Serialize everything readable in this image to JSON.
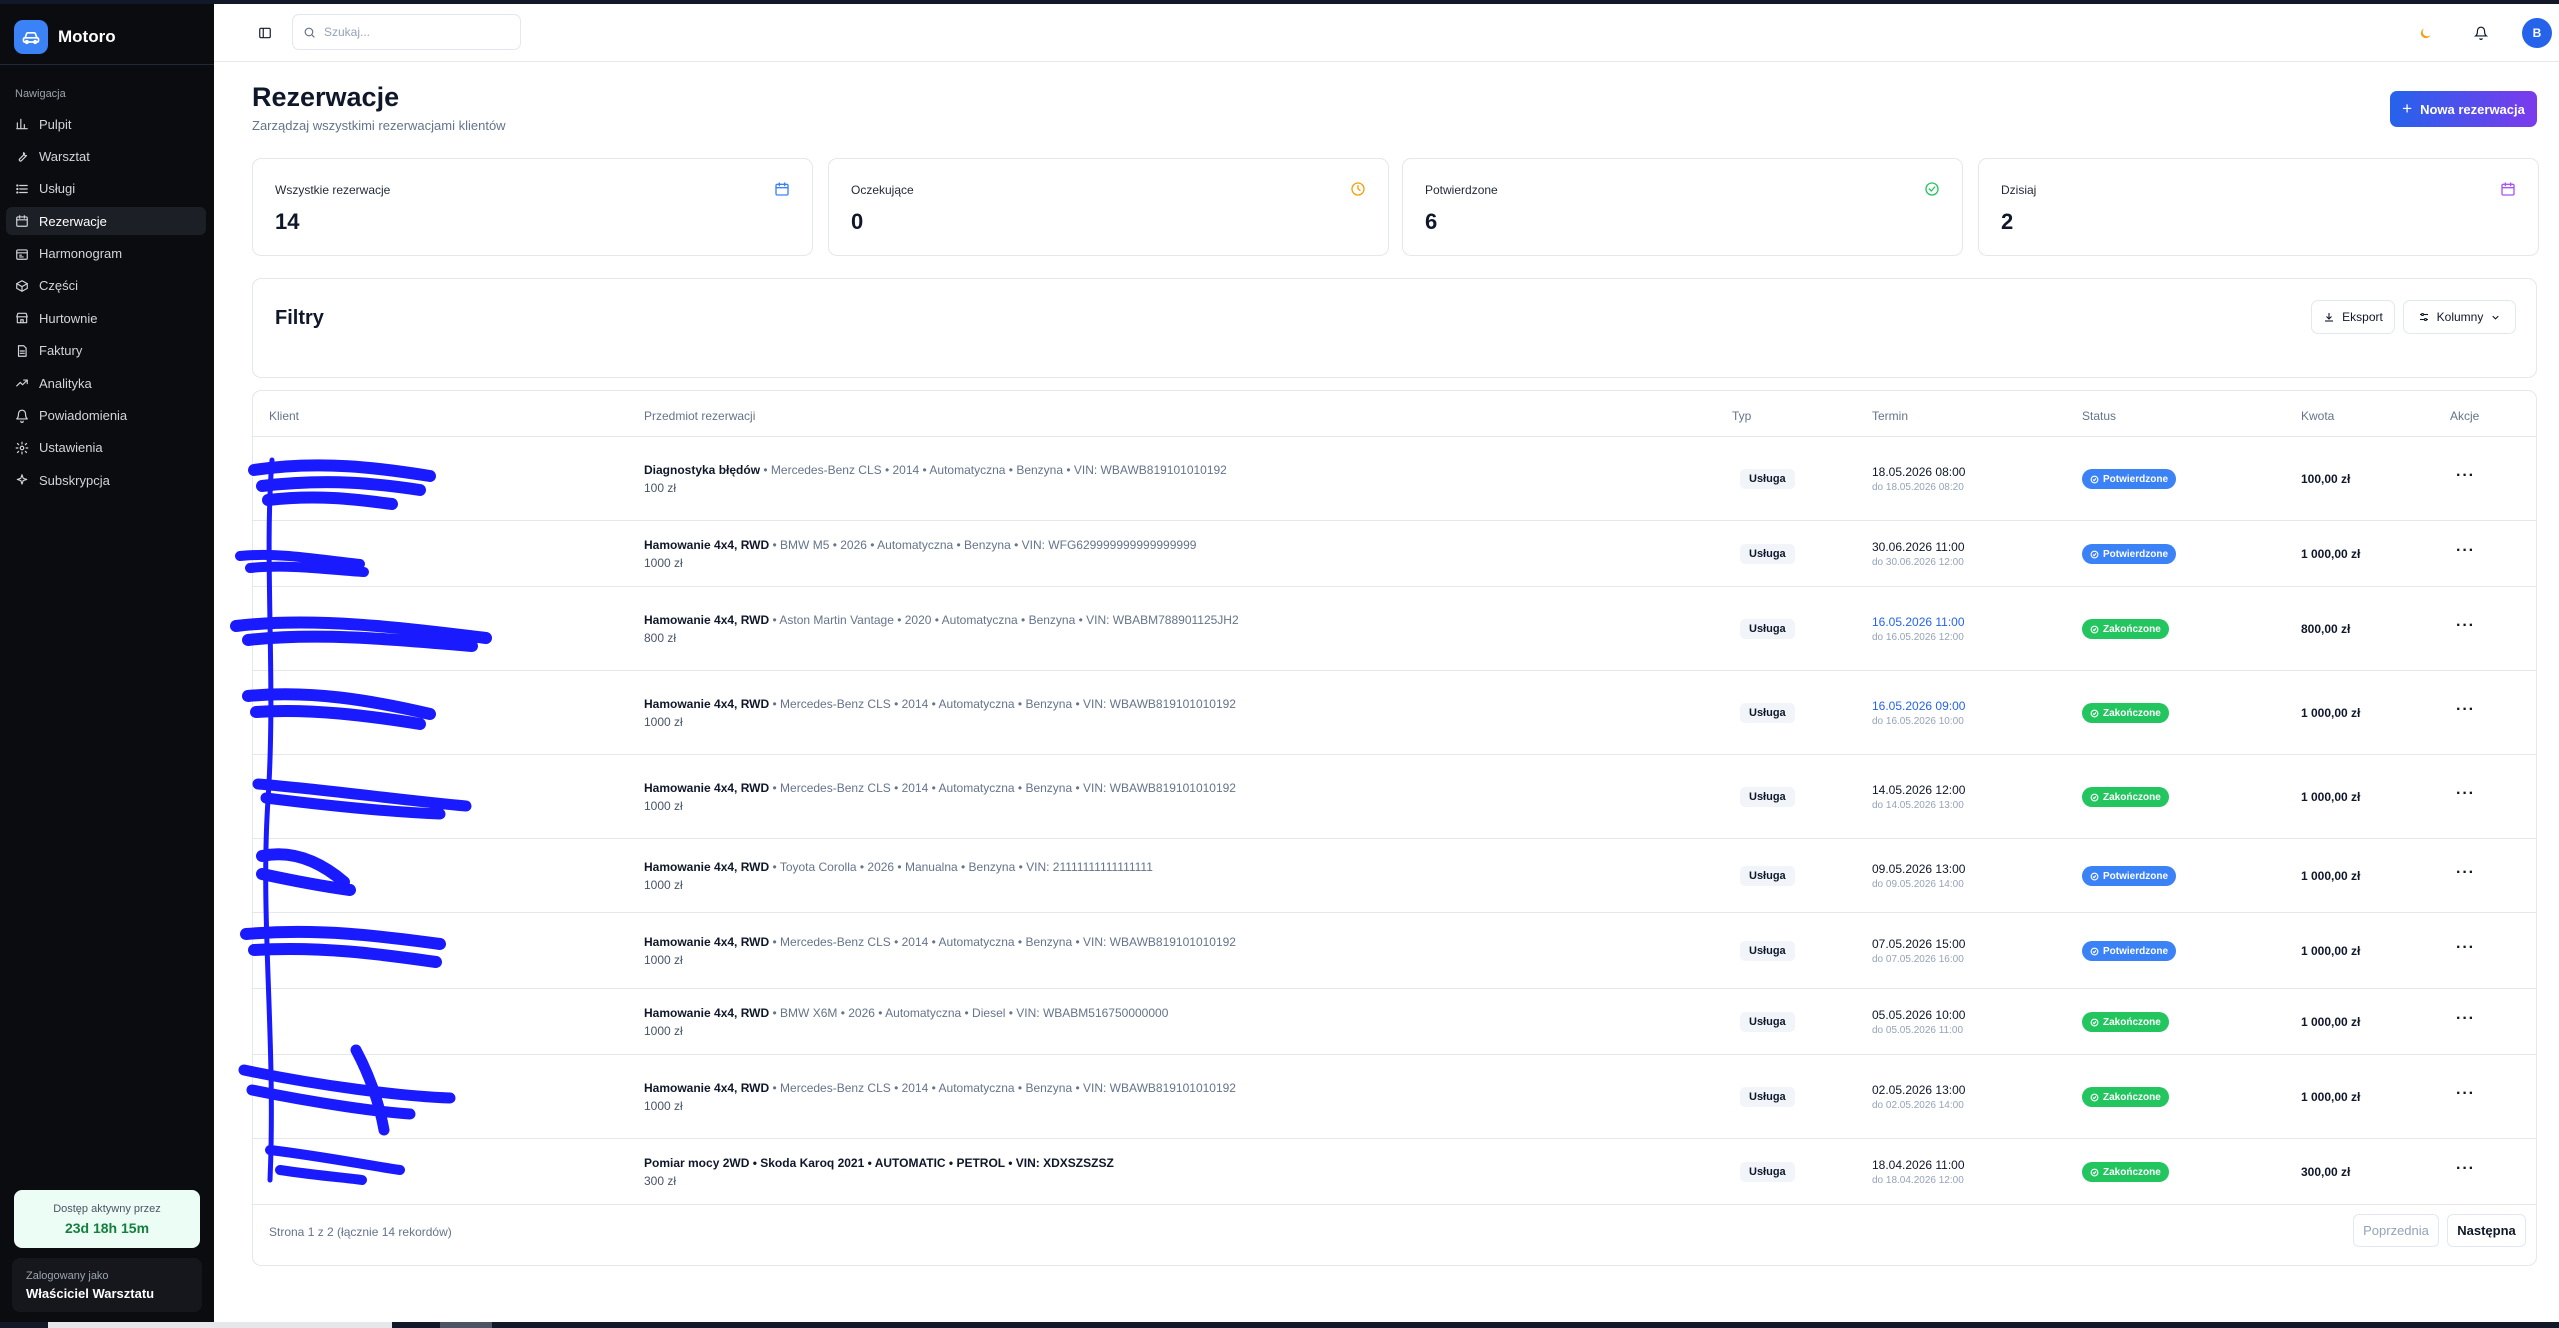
{
  "app": {
    "name": "Motoro"
  },
  "sidebar": {
    "section_label": "Nawigacja",
    "items": [
      {
        "label": "Pulpit",
        "icon": "chart-bar-icon"
      },
      {
        "label": "Warsztat",
        "icon": "wrench-icon"
      },
      {
        "label": "Usługi",
        "icon": "list-icon"
      },
      {
        "label": "Rezerwacje",
        "icon": "calendar-icon",
        "active": true
      },
      {
        "label": "Harmonogram",
        "icon": "schedule-icon"
      },
      {
        "label": "Części",
        "icon": "box-icon"
      },
      {
        "label": "Hurtownie",
        "icon": "store-icon"
      },
      {
        "label": "Faktury",
        "icon": "invoice-icon"
      },
      {
        "label": "Analityka",
        "icon": "trend-icon"
      },
      {
        "label": "Powiadomienia",
        "icon": "bell-icon"
      },
      {
        "label": "Ustawienia",
        "icon": "gear-icon"
      },
      {
        "label": "Subskrypcja",
        "icon": "sparkle-icon"
      }
    ],
    "access": {
      "label": "Dostęp aktywny przez",
      "value": "23d 18h 15m"
    },
    "user": {
      "label": "Zalogowany jako",
      "name": "Właściciel Warsztatu"
    }
  },
  "header": {
    "search_placeholder": "Szukaj...",
    "avatar_initial": "B"
  },
  "page": {
    "title": "Rezerwacje",
    "subtitle": "Zarządzaj wszystkimi rezerwacjami klientów",
    "new_button": "Nowa rezerwacja"
  },
  "stats": [
    {
      "label": "Wszystkie rezerwacje",
      "value": "14",
      "icon": "calendar-icon",
      "color": "#3b82f6"
    },
    {
      "label": "Oczekujące",
      "value": "0",
      "icon": "clock-icon",
      "color": "#f59e0b"
    },
    {
      "label": "Potwierdzone",
      "value": "6",
      "icon": "check-circle-icon",
      "color": "#22c55e"
    },
    {
      "label": "Dzisiaj",
      "value": "2",
      "icon": "calendar-icon",
      "color": "#a855f7"
    }
  ],
  "filters": {
    "title": "Filtry",
    "export_label": "Eksport",
    "columns_label": "Kolumny"
  },
  "table": {
    "columns": [
      "Klient",
      "Przedmiot rezerwacji",
      "Typ",
      "Termin",
      "Status",
      "Kwota",
      "Akcje"
    ],
    "rows": [
      {
        "service": "Diagnostyka błędów",
        "details": "Mercedes-Benz CLS • 2014 • Automatyczna • Benzyna • VIN: WBAWB819101010192",
        "price": "100 zł",
        "type": "Usługa",
        "date": "18.05.2026 08:00",
        "until": "do 18.05.2026 08:20",
        "status": "Potwierdzone",
        "amount": "100,00 zł"
      },
      {
        "service": "Hamowanie 4x4, RWD",
        "details": "BMW M5 • 2026 • Automatyczna • Benzyna • VIN: WFG629999999999999999",
        "price": "1000 zł",
        "type": "Usługa",
        "date": "30.06.2026 11:00",
        "until": "do 30.06.2026 12:00",
        "status": "Potwierdzone",
        "amount": "1 000,00 zł"
      },
      {
        "service": "Hamowanie 4x4, RWD",
        "details": "Aston Martin Vantage • 2020 • Automatyczna • Benzyna • VIN: WBABM788901125JH2",
        "price": "800 zł",
        "type": "Usługa",
        "date": "16.05.2026 11:00",
        "until": "do 16.05.2026 12:00",
        "status": "Zakończone",
        "amount": "800,00 zł",
        "highlight": true
      },
      {
        "service": "Hamowanie 4x4, RWD",
        "details": "Mercedes-Benz CLS • 2014 • Automatyczna • Benzyna • VIN: WBAWB819101010192",
        "price": "1000 zł",
        "type": "Usługa",
        "date": "16.05.2026 09:00",
        "until": "do 16.05.2026 10:00",
        "status": "Zakończone",
        "amount": "1 000,00 zł",
        "highlight": true
      },
      {
        "service": "Hamowanie 4x4, RWD",
        "details": "Mercedes-Benz CLS • 2014 • Automatyczna • Benzyna • VIN: WBAWB819101010192",
        "price": "1000 zł",
        "type": "Usługa",
        "date": "14.05.2026 12:00",
        "until": "do 14.05.2026 13:00",
        "status": "Zakończone",
        "amount": "1 000,00 zł"
      },
      {
        "service": "Hamowanie 4x4, RWD",
        "details": "Toyota Corolla • 2026 • Manualna • Benzyna • VIN: 21111111111111111",
        "price": "1000 zł",
        "type": "Usługa",
        "date": "09.05.2026 13:00",
        "until": "do 09.05.2026 14:00",
        "status": "Potwierdzone",
        "amount": "1 000,00 zł"
      },
      {
        "service": "Hamowanie 4x4, RWD",
        "details": "Mercedes-Benz CLS • 2014 • Automatyczna • Benzyna • VIN: WBAWB819101010192",
        "price": "1000 zł",
        "type": "Usługa",
        "date": "07.05.2026 15:00",
        "until": "do 07.05.2026 16:00",
        "status": "Potwierdzone",
        "amount": "1 000,00 zł"
      },
      {
        "service": "Hamowanie 4x4, RWD",
        "details": "BMW X6M • 2026 • Automatyczna • Diesel • VIN: WBABM516750000000",
        "price": "1000 zł",
        "type": "Usługa",
        "date": "05.05.2026 10:00",
        "until": "do 05.05.2026 11:00",
        "status": "Zakończone",
        "amount": "1 000,00 zł"
      },
      {
        "service": "Hamowanie 4x4, RWD",
        "details": "Mercedes-Benz CLS • 2014 • Automatyczna • Benzyna • VIN: WBAWB819101010192",
        "price": "1000 zł",
        "type": "Usługa",
        "date": "02.05.2026 13:00",
        "until": "do 02.05.2026 14:00",
        "status": "Zakończone",
        "amount": "1 000,00 zł"
      },
      {
        "service": "Pomiar mocy 2WD • Skoda Karoq 2021 • AUTOMATIC • PETROL • VIN: XDXSZSZSZ",
        "details": "",
        "price": "300 zł",
        "type": "Usługa",
        "date": "18.04.2026 11:00",
        "until": "do 18.04.2026 12:00",
        "status": "Zakończone",
        "amount": "300,00 zł"
      }
    ]
  },
  "pagination": {
    "info": "Strona 1 z 2 (łącznie 14 rekordów)",
    "prev": "Poprzednia",
    "next": "Następna"
  }
}
